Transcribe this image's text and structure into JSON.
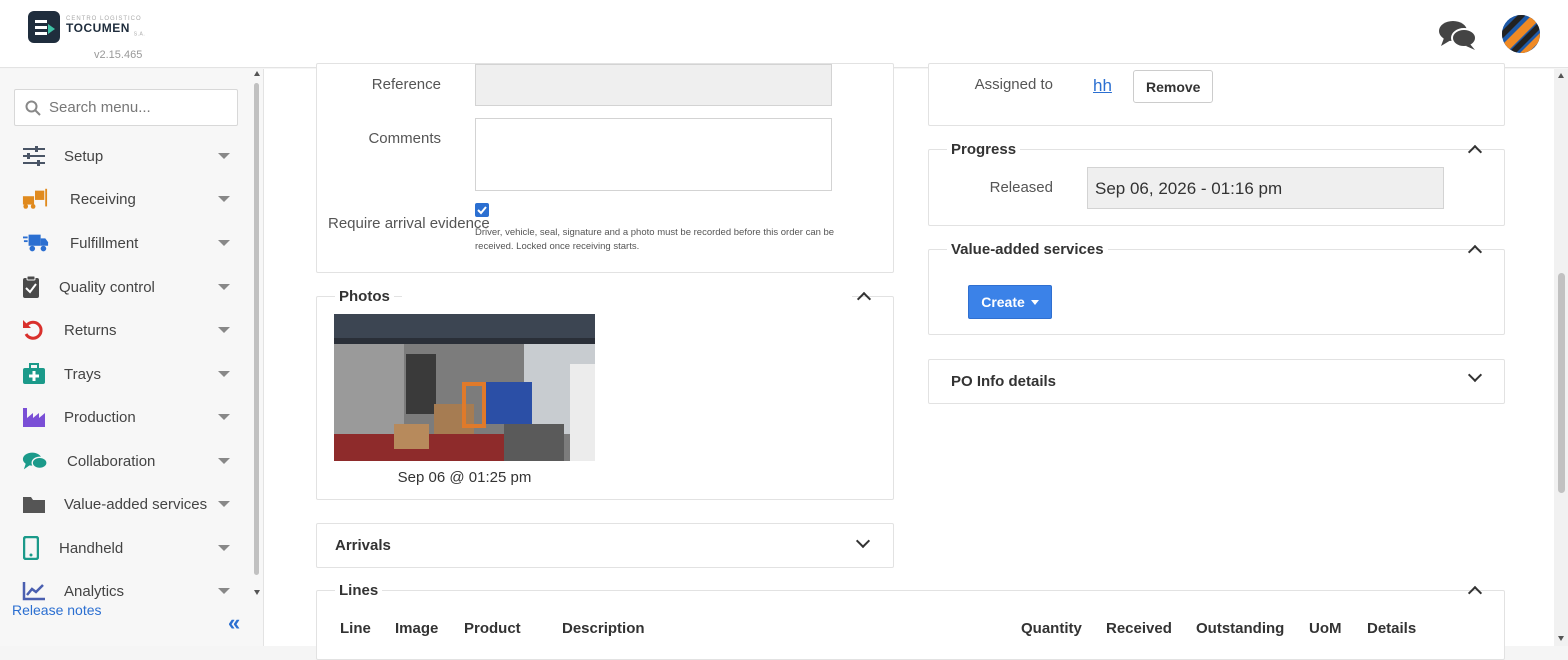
{
  "header": {
    "brand_small": "CENTRO LOGISTICO",
    "brand": "TOCUMEN",
    "brand_suffix": "S.A.",
    "version": "v2.15.465"
  },
  "sidebar": {
    "search_placeholder": "Search menu...",
    "items": [
      {
        "label": "Setup",
        "icon": "sliders-icon"
      },
      {
        "label": "Receiving",
        "icon": "forklift-icon"
      },
      {
        "label": "Fulfillment",
        "icon": "truck-icon"
      },
      {
        "label": "Quality control",
        "icon": "clipboard-check-icon"
      },
      {
        "label": "Returns",
        "icon": "undo-icon"
      },
      {
        "label": "Trays",
        "icon": "medkit-icon"
      },
      {
        "label": "Production",
        "icon": "factory-icon"
      },
      {
        "label": "Collaboration",
        "icon": "comments-icon"
      },
      {
        "label": "Value-added services",
        "icon": "folder-icon"
      },
      {
        "label": "Handheld",
        "icon": "mobile-icon"
      },
      {
        "label": "Analytics",
        "icon": "chart-line-icon"
      }
    ],
    "release_notes": "Release notes",
    "collapse_glyph": "«"
  },
  "form": {
    "reference_label": "Reference",
    "reference_value": "",
    "comments_label": "Comments",
    "comments_value": "",
    "require_evidence_label": "Require arrival evidence",
    "require_evidence_checked": true,
    "require_evidence_help": "Driver, vehicle, seal, signature and a photo must be recorded before this order can be received. Locked once receiving starts."
  },
  "photos": {
    "title": "Photos",
    "caption": "Sep 06 @ 01:25 pm"
  },
  "arrivals": {
    "title": "Arrivals"
  },
  "lines": {
    "title": "Lines",
    "columns": [
      "Line",
      "Image",
      "Product",
      "Description",
      "Quantity",
      "Received",
      "Outstanding",
      "UoM",
      "Details"
    ]
  },
  "assignment": {
    "assigned_label": "Assigned to",
    "assigned_value": "hh",
    "remove_label": "Remove"
  },
  "progress": {
    "title": "Progress",
    "released_label": "Released",
    "released_value": "Sep 06, 2026 - 01:16 pm"
  },
  "vas": {
    "title": "Value-added services",
    "create_label": "Create"
  },
  "po_info": {
    "title": "PO Info details"
  },
  "colors": {
    "accent": "#3b82e8",
    "link": "#2b6fd1",
    "brand_dark": "#1f2d3d"
  }
}
